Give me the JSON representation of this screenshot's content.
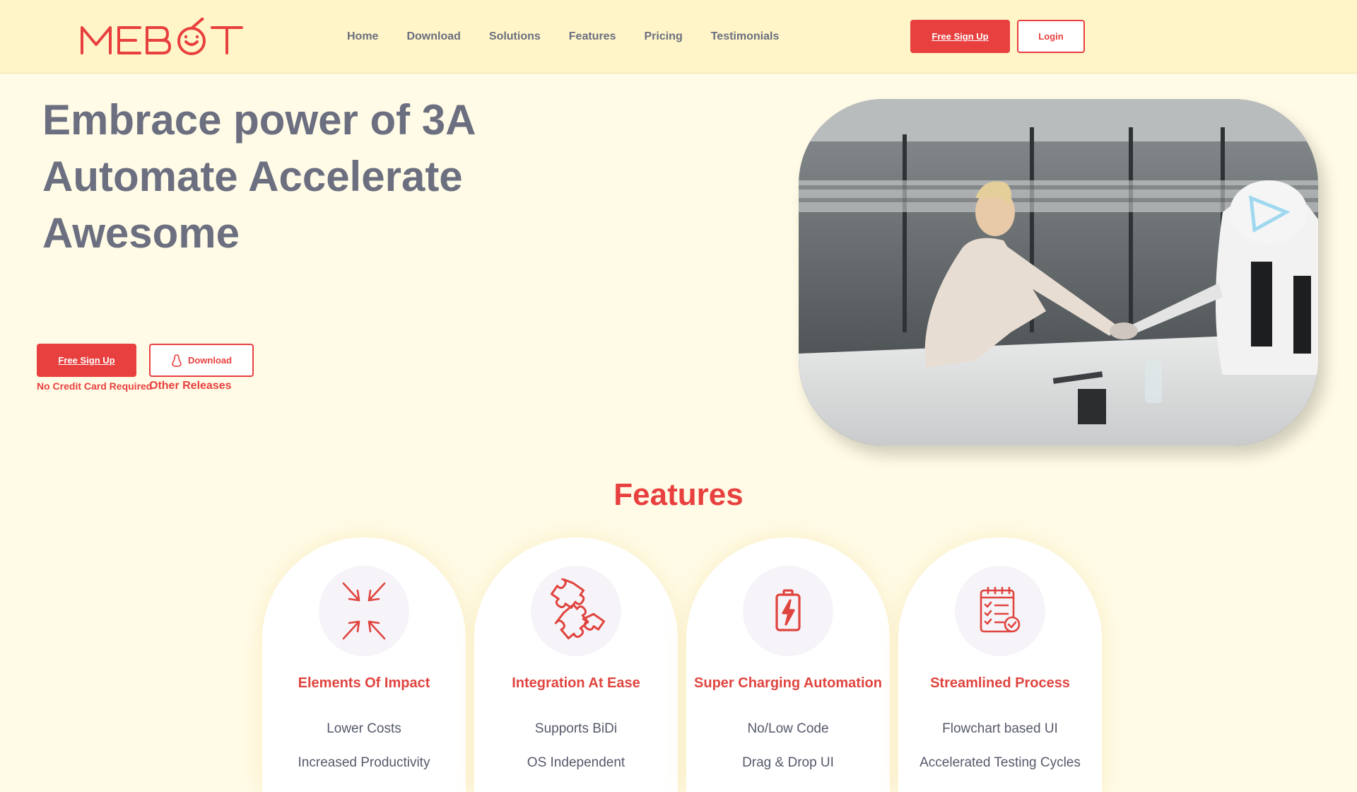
{
  "brand": {
    "logo_text": "MEBOT",
    "accent": "#e8403f",
    "header_bg": "#fff5c8",
    "page_bg": "#fffbe6"
  },
  "nav": {
    "items": [
      "Home",
      "Download",
      "Solutions",
      "Features",
      "Pricing",
      "Testimonials"
    ]
  },
  "header_actions": {
    "signup_label": "Free Sign Up",
    "login_label": "Login"
  },
  "hero": {
    "title_lines": [
      "Embrace power of 3A",
      "Automate Accelerate",
      "Awesome"
    ],
    "signup_label": "Free Sign Up",
    "signup_note": "No Credit Card Required",
    "download_label": "Download",
    "download_icon": "linux-tux-icon",
    "download_note": "Other Releases"
  },
  "features": {
    "heading": "Features",
    "cards": [
      {
        "icon": "arrows-converge-icon",
        "title": "Elements Of Impact",
        "items": [
          "Lower Costs",
          "Increased Productivity"
        ]
      },
      {
        "icon": "puzzle-icon",
        "title": "Integration At Ease",
        "items": [
          "Supports BiDi",
          "OS Independent"
        ]
      },
      {
        "icon": "battery-charging-icon",
        "title": "Super Charging Automation",
        "items": [
          "No/Low Code",
          "Drag & Drop UI"
        ]
      },
      {
        "icon": "clipboard-checklist-icon",
        "title": "Streamlined Process",
        "items": [
          "Flowchart based UI",
          "Accelerated Testing Cycles"
        ]
      }
    ]
  }
}
